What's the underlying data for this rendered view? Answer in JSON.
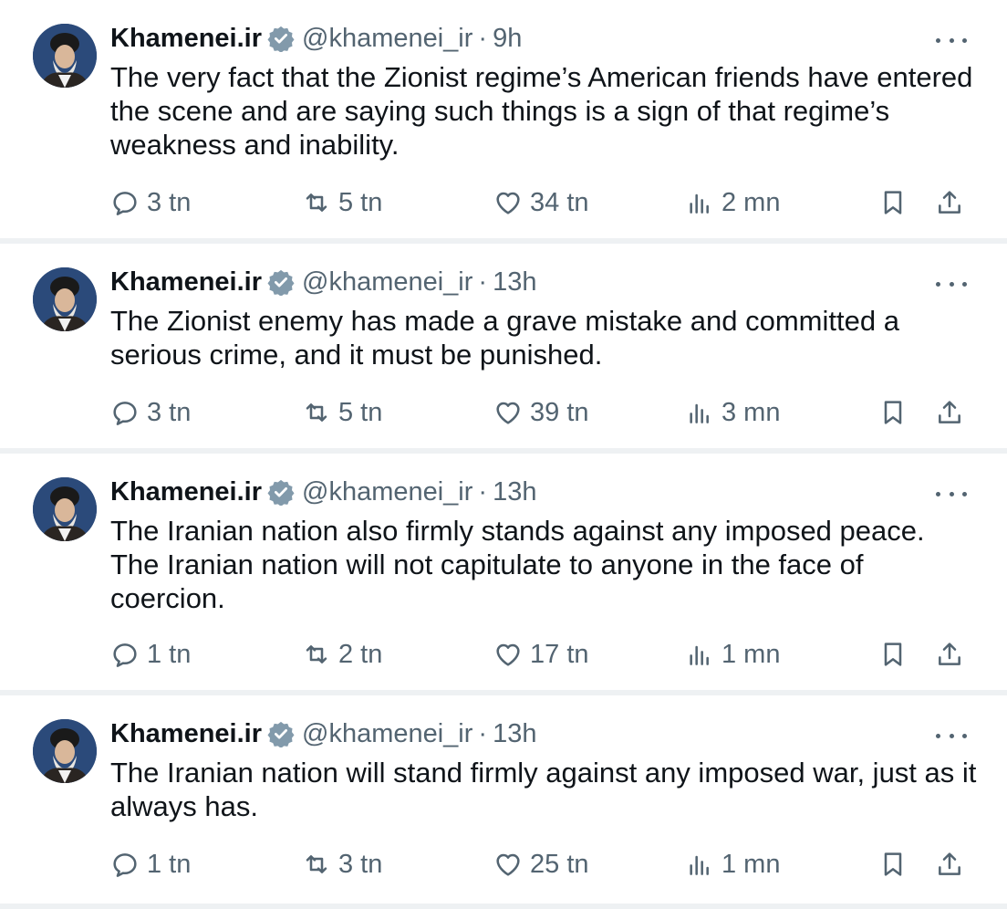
{
  "tweets": [
    {
      "author": "Khamenei.ir",
      "handle": "@khamenei_ir",
      "separator": "·",
      "time": "9h",
      "text": "The very fact that the Zionist regime’s American friends have entered the scene and are saying such things is a sign of that regime’s weakness and inability.",
      "replies": "3 tn",
      "reposts": "5 tn",
      "likes": "34 tn",
      "views": "2 mn"
    },
    {
      "author": "Khamenei.ir",
      "handle": "@khamenei_ir",
      "separator": "·",
      "time": "13h",
      "text": "The Zionist enemy has made a grave mistake and committed a serious crime, and it must be punished.",
      "replies": "3 tn",
      "reposts": "5 tn",
      "likes": "39 tn",
      "views": "3 mn"
    },
    {
      "author": "Khamenei.ir",
      "handle": "@khamenei_ir",
      "separator": "·",
      "time": "13h",
      "text": "The Iranian nation also firmly stands against any imposed peace. The Iranian nation will not capitulate to anyone in the face of coercion.",
      "replies": "1 tn",
      "reposts": "2 tn",
      "likes": "17 tn",
      "views": "1 mn"
    },
    {
      "author": "Khamenei.ir",
      "handle": "@khamenei_ir",
      "separator": "·",
      "time": "13h",
      "text": "The Iranian nation will stand firmly against any imposed war, just as it always has.",
      "replies": "1 tn",
      "reposts": "3 tn",
      "likes": "25 tn",
      "views": "1 mn"
    }
  ],
  "icons": {
    "verified": "verified-badge-icon",
    "more": "more-options-icon",
    "reply": "reply-icon",
    "repost": "repost-icon",
    "like": "heart-icon",
    "views": "views-chart-icon",
    "bookmark": "bookmark-icon",
    "share": "share-icon"
  },
  "colors": {
    "text_primary": "#0f1419",
    "text_secondary": "#536471",
    "verified_badge": "#829aab",
    "divider": "#eef1f3"
  }
}
